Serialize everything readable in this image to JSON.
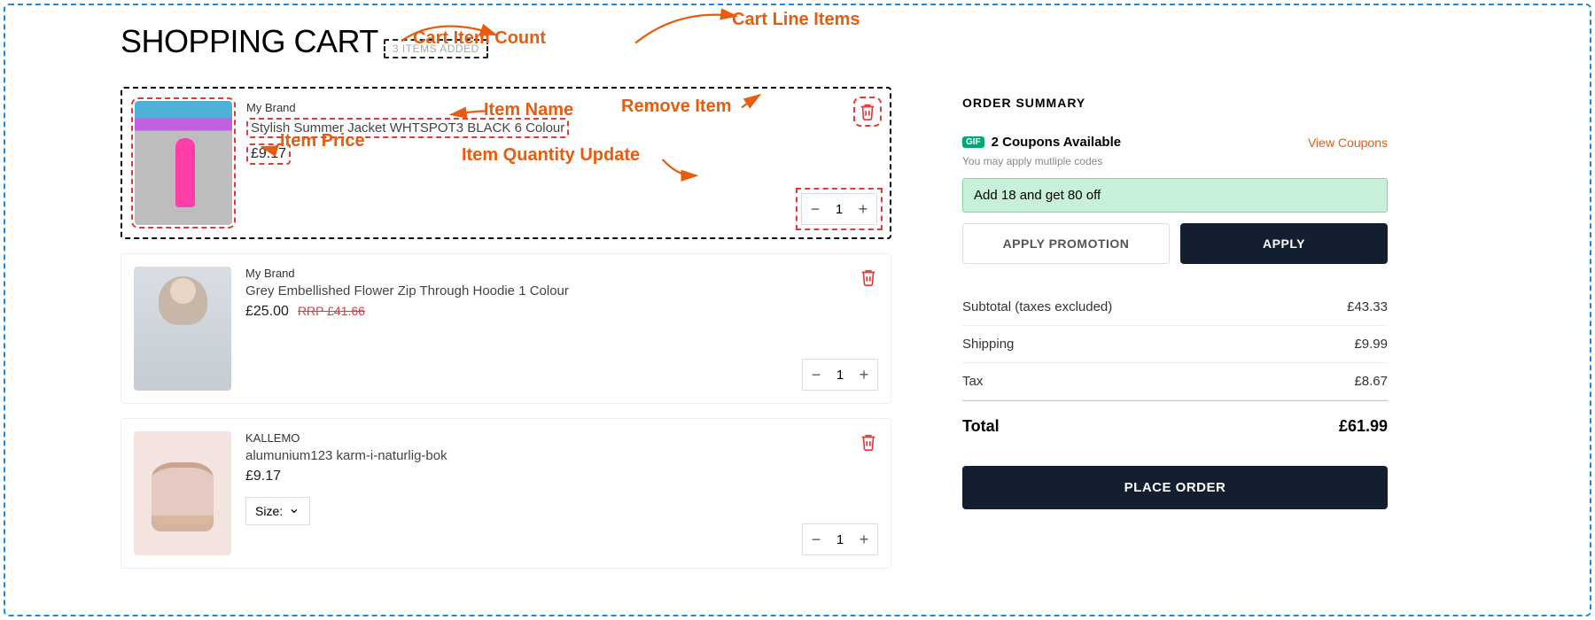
{
  "header": {
    "title": "SHOPPING CART",
    "items_added_label": "3 ITEMS ADDED"
  },
  "annotations": {
    "cart_item_count": "Cart Item Count",
    "cart_line_items": "Cart Line Items",
    "item_name": "Item Name",
    "item_price": "Item Price",
    "remove_item": "Remove Item",
    "item_qty_update": "Item Quantity Update"
  },
  "items": [
    {
      "brand": "My Brand",
      "name": "Stylish Summer Jacket WHTSPOT3 BLACK 6 Colour",
      "price": "£9.17",
      "rrp": "",
      "qty": "1",
      "size_label": "",
      "thumb_class": "thumb-pink",
      "annotated": true
    },
    {
      "brand": "My Brand",
      "name": "Grey Embellished Flower Zip Through Hoodie 1 Colour",
      "price": "£25.00",
      "rrp": "RRP £41.66",
      "qty": "1",
      "size_label": "",
      "thumb_class": "thumb-grey",
      "annotated": false
    },
    {
      "brand": "KALLEMO",
      "name": "alumunium123 karm-i-naturlig-bok",
      "price": "£9.17",
      "rrp": "",
      "qty": "1",
      "size_label": "Size:",
      "thumb_class": "thumb-chair",
      "annotated": false
    }
  ],
  "summary": {
    "title": "ORDER SUMMARY",
    "badge": "GIF",
    "coupons_text": "2 Coupons Available",
    "view_coupons": "View Coupons",
    "hint": "You may apply mutliple codes",
    "promo_note": "Add 18 and get 80 off",
    "apply_promotion": "APPLY PROMOTION",
    "apply": "APPLY",
    "lines": {
      "subtotal_label": "Subtotal (taxes excluded)",
      "subtotal_value": "£43.33",
      "shipping_label": "Shipping",
      "shipping_value": "£9.99",
      "tax_label": "Tax",
      "tax_value": "£8.67",
      "total_label": "Total",
      "total_value": "£61.99"
    },
    "place_order": "PLACE ORDER"
  },
  "glyphs": {
    "minus": "−",
    "plus": "+",
    "chev_down": "⌄"
  }
}
